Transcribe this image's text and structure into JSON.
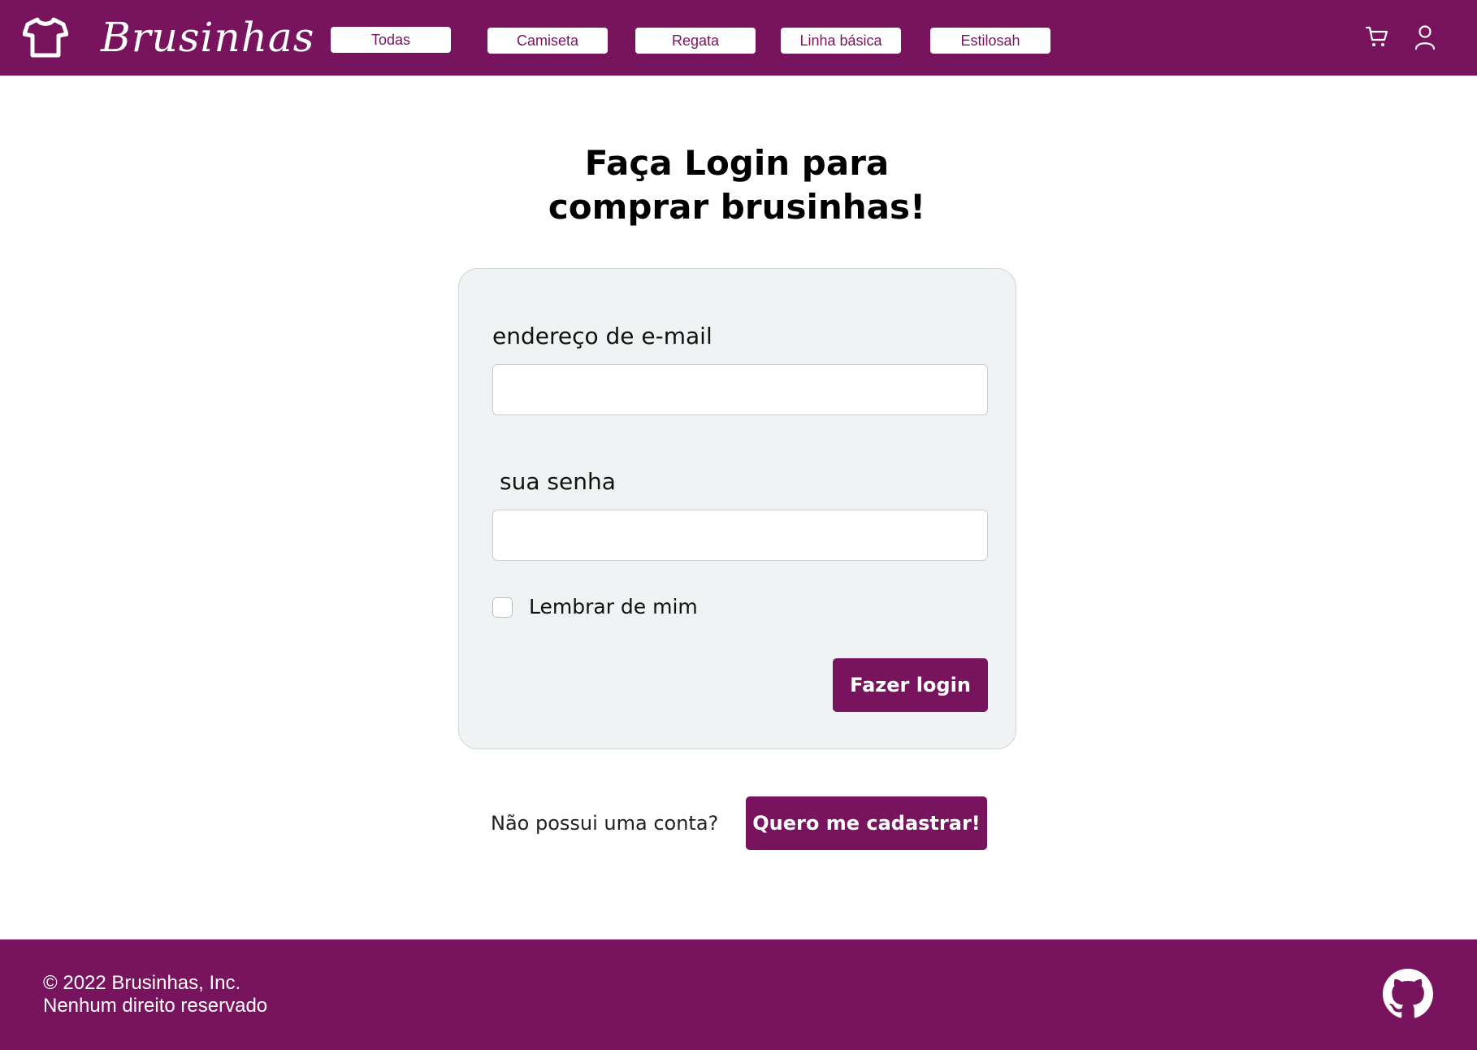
{
  "header": {
    "brand": "Brusinhas",
    "nav": [
      {
        "label": "Todas"
      },
      {
        "label": "Camiseta"
      },
      {
        "label": "Regata"
      },
      {
        "label": "Linha básica"
      },
      {
        "label": "Estilosah"
      }
    ],
    "icons": [
      "tshirt-icon",
      "cart-icon",
      "user-icon"
    ]
  },
  "main": {
    "title_line1": "Faça Login para",
    "title_line2": "comprar brusinhas!",
    "form": {
      "email_label": "endereço de e-mail",
      "email_value": "",
      "password_label": "sua senha",
      "password_value": "",
      "remember_label": "Lembrar de mim",
      "remember_checked": false,
      "submit_label": "Fazer login"
    },
    "signup": {
      "prompt": "Não possui uma conta?",
      "button_label": "Quero me cadastrar!"
    }
  },
  "footer": {
    "copyright": "© 2022 Brusinhas, Inc.",
    "rights": "Nenhum direito reservado",
    "icon": "github-icon"
  },
  "colors": {
    "brand": "#78145e",
    "card_bg": "#f0f3f4",
    "text": "#000000"
  }
}
